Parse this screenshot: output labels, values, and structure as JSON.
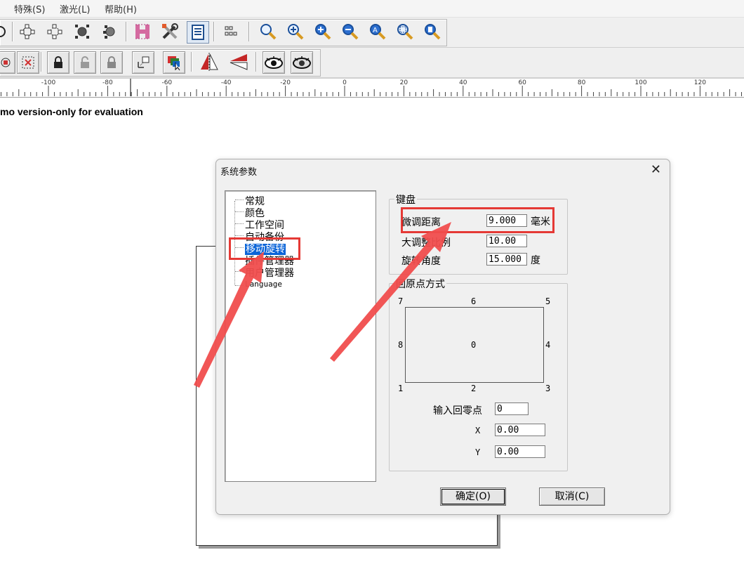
{
  "menu": {
    "items": [
      "特殊(S)",
      "激光(L)",
      "帮助(H)"
    ]
  },
  "toolbar1": {
    "icons": [
      "circle-partial-icon",
      "node-select-icon",
      "node-dots-icon",
      "node-fill-icon",
      "node-fill-2-icon",
      "h-letter-icon",
      "tools-icon",
      "list-doc-icon",
      "grid-icon",
      "zoom-search-icon",
      "zoom-plus-icon",
      "zoom-plus-circle-icon",
      "zoom-minus-icon",
      "zoom-a-icon",
      "zoom-fit-icon",
      "zoom-page-icon"
    ]
  },
  "toolbar2": {
    "icons": [
      "node-rotate-icon",
      "grid-select-icon",
      "lock-icon",
      "unlock-icon",
      "lock-gray-icon",
      "align-icon",
      "color-layers-icon",
      "mirror-h-icon",
      "mirror-v-icon",
      "eye-icon",
      "eye-2-icon"
    ]
  },
  "ruler": {
    "labels": [
      "-100",
      "-80",
      "-60",
      "-40",
      "-20",
      "0",
      "20",
      "40",
      "60",
      "80",
      "100",
      "120"
    ]
  },
  "canvas": {
    "demo_note": "mo version-only for evaluation"
  },
  "dialog": {
    "title": "系统参数",
    "close": "✕",
    "tree": [
      "常规",
      "颜色",
      "工作空间",
      "自动备份",
      "移动旋转",
      "插件管理器",
      "用户管理器",
      "Language"
    ],
    "selected_index": 4,
    "keyboard": {
      "group_title": "键盘",
      "fine_distance_label": "微调距离",
      "fine_distance_value": "9.000",
      "fine_distance_unit": "毫米",
      "coarse_ratio_label": "大调整比例",
      "coarse_ratio_value": "10.00",
      "rotate_angle_label": "旋转角度",
      "rotate_angle_value": "15.000",
      "rotate_angle_unit": "度"
    },
    "origin": {
      "group_title": "回原点方式",
      "points": {
        "p7": "7",
        "p6": "6",
        "p5": "5",
        "p8": "8",
        "p0": "0",
        "p4": "4",
        "p1": "1",
        "p2": "2",
        "p3": "3"
      },
      "input_label": "输入回零点",
      "input_value": "0",
      "x_label": "X",
      "x_value": "0.00",
      "y_label": "Y",
      "y_value": "0.00"
    },
    "ok_label": "确定(O)",
    "cancel_label": "取消(C)"
  },
  "annotation": {
    "highlight_color": "#e53935",
    "arrow_color": "#f04d4d"
  }
}
